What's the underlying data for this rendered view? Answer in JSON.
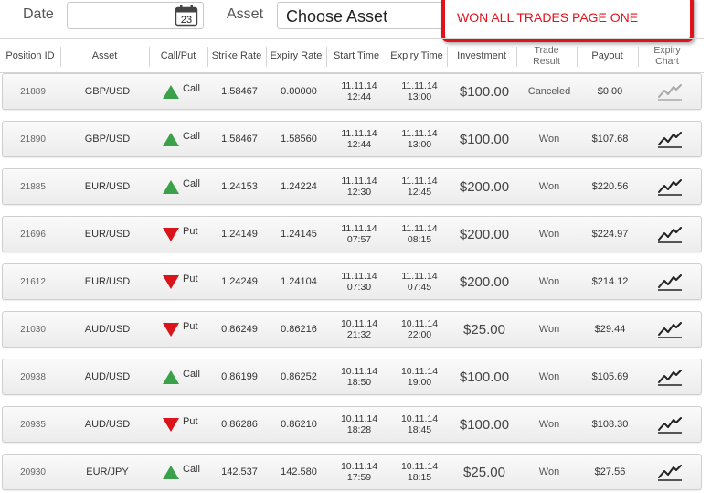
{
  "filters": {
    "date_label": "Date",
    "calendar_day": "23",
    "asset_label": "Asset",
    "asset_value": "Choose Asset"
  },
  "annotation": "WON ALL TRADES PAGE ONE",
  "columns": [
    "Position ID",
    "Asset",
    "Call/Put",
    "Strike Rate",
    "Expiry Rate",
    "Start Time",
    "Expiry Time",
    "Investment",
    "Trade Result",
    "Payout",
    "Expiry Chart"
  ],
  "trades": [
    {
      "id": "21889",
      "asset": "GBP/USD",
      "dir": "Call",
      "strike": "1.58467",
      "expiry_rate": "0.00000",
      "start_date": "11.11.14",
      "start_time": "12:44",
      "exp_date": "11.11.14",
      "exp_time": "13:00",
      "investment": "$100.00",
      "result": "Canceled",
      "payout": "$0.00",
      "chart_active": false
    },
    {
      "id": "21890",
      "asset": "GBP/USD",
      "dir": "Call",
      "strike": "1.58467",
      "expiry_rate": "1.58560",
      "start_date": "11.11.14",
      "start_time": "12:44",
      "exp_date": "11.11.14",
      "exp_time": "13:00",
      "investment": "$100.00",
      "result": "Won",
      "payout": "$107.68",
      "chart_active": true
    },
    {
      "id": "21885",
      "asset": "EUR/USD",
      "dir": "Call",
      "strike": "1.24153",
      "expiry_rate": "1.24224",
      "start_date": "11.11.14",
      "start_time": "12:30",
      "exp_date": "11.11.14",
      "exp_time": "12:45",
      "investment": "$200.00",
      "result": "Won",
      "payout": "$220.56",
      "chart_active": true
    },
    {
      "id": "21696",
      "asset": "EUR/USD",
      "dir": "Put",
      "strike": "1.24149",
      "expiry_rate": "1.24145",
      "start_date": "11.11.14",
      "start_time": "07:57",
      "exp_date": "11.11.14",
      "exp_time": "08:15",
      "investment": "$200.00",
      "result": "Won",
      "payout": "$224.97",
      "chart_active": true
    },
    {
      "id": "21612",
      "asset": "EUR/USD",
      "dir": "Put",
      "strike": "1.24249",
      "expiry_rate": "1.24104",
      "start_date": "11.11.14",
      "start_time": "07:30",
      "exp_date": "11.11.14",
      "exp_time": "07:45",
      "investment": "$200.00",
      "result": "Won",
      "payout": "$214.12",
      "chart_active": true
    },
    {
      "id": "21030",
      "asset": "AUD/USD",
      "dir": "Put",
      "strike": "0.86249",
      "expiry_rate": "0.86216",
      "start_date": "10.11.14",
      "start_time": "21:32",
      "exp_date": "10.11.14",
      "exp_time": "22:00",
      "investment": "$25.00",
      "result": "Won",
      "payout": "$29.44",
      "chart_active": true
    },
    {
      "id": "20938",
      "asset": "AUD/USD",
      "dir": "Call",
      "strike": "0.86199",
      "expiry_rate": "0.86252",
      "start_date": "10.11.14",
      "start_time": "18:50",
      "exp_date": "10.11.14",
      "exp_time": "19:00",
      "investment": "$100.00",
      "result": "Won",
      "payout": "$105.69",
      "chart_active": true
    },
    {
      "id": "20935",
      "asset": "AUD/USD",
      "dir": "Put",
      "strike": "0.86286",
      "expiry_rate": "0.86210",
      "start_date": "10.11.14",
      "start_time": "18:28",
      "exp_date": "10.11.14",
      "exp_time": "18:45",
      "investment": "$100.00",
      "result": "Won",
      "payout": "$108.30",
      "chart_active": true
    },
    {
      "id": "20930",
      "asset": "EUR/JPY",
      "dir": "Call",
      "strike": "142.537",
      "expiry_rate": "142.580",
      "start_date": "10.11.14",
      "start_time": "17:59",
      "exp_date": "10.11.14",
      "exp_time": "18:15",
      "investment": "$25.00",
      "result": "Won",
      "payout": "$27.56",
      "chart_active": true
    }
  ],
  "colors": {
    "call": "#3aa04a",
    "put": "#d9141b",
    "annotation": "#e0121b"
  },
  "icons": {
    "date": "calendar-icon",
    "chart": "trend-chart-icon",
    "call": "arrow-up-triangle-icon",
    "put": "arrow-down-triangle-icon"
  }
}
